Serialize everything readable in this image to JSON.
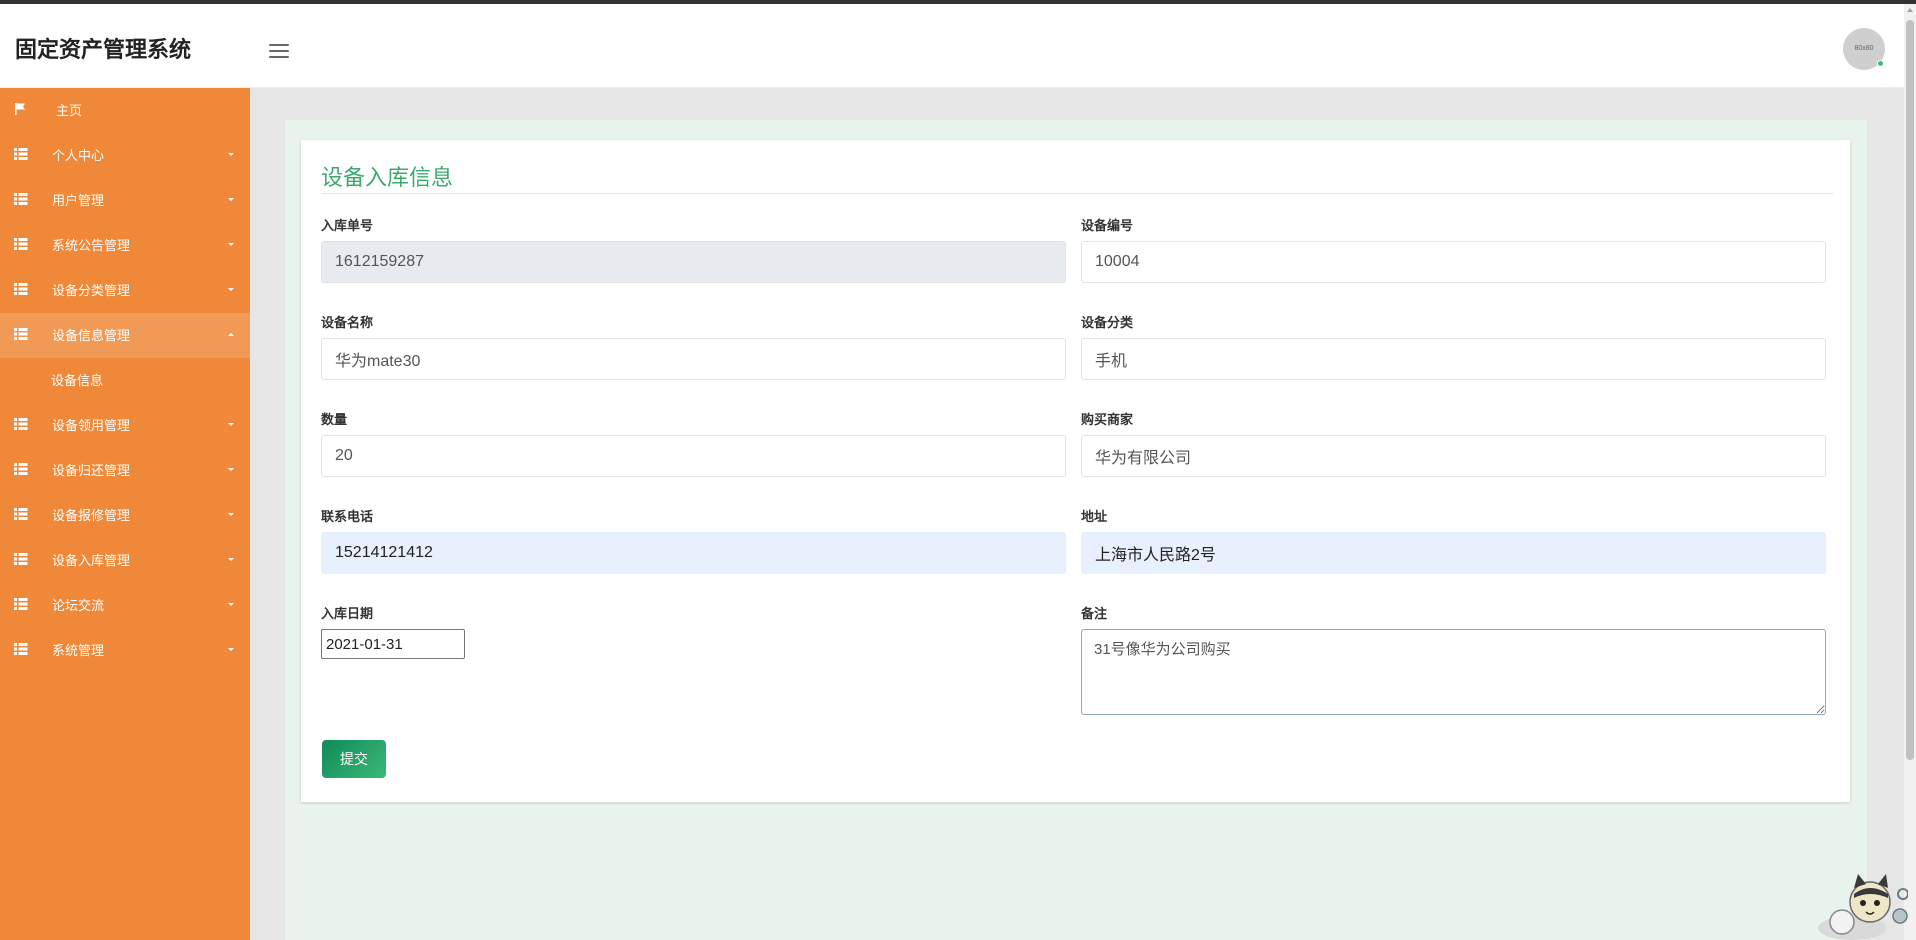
{
  "header": {
    "app_title": "固定资产管理系统",
    "avatar_text": "80x80"
  },
  "sidebar": {
    "items": [
      {
        "label": "主页",
        "icon": "flag-icon"
      },
      {
        "label": "个人中心",
        "icon": "grid-icon"
      },
      {
        "label": "用户管理",
        "icon": "grid-icon"
      },
      {
        "label": "系统公告管理",
        "icon": "grid-icon"
      },
      {
        "label": "设备分类管理",
        "icon": "grid-icon"
      },
      {
        "label": "设备信息管理",
        "icon": "grid-icon",
        "expanded": true
      },
      {
        "label": "设备领用管理",
        "icon": "grid-icon"
      },
      {
        "label": "设备归还管理",
        "icon": "grid-icon"
      },
      {
        "label": "设备报修管理",
        "icon": "grid-icon"
      },
      {
        "label": "设备入库管理",
        "icon": "grid-icon"
      },
      {
        "label": "论坛交流",
        "icon": "grid-icon"
      },
      {
        "label": "系统管理",
        "icon": "grid-icon"
      }
    ],
    "sub_item": "设备信息"
  },
  "form": {
    "title": "设备入库信息",
    "fields": {
      "order_no": {
        "label": "入库单号",
        "value": "1612159287"
      },
      "device_no": {
        "label": "设备编号",
        "value": "10004"
      },
      "device_name": {
        "label": "设备名称",
        "value": "华为mate30"
      },
      "category": {
        "label": "设备分类",
        "value": "手机"
      },
      "quantity": {
        "label": "数量",
        "value": "20"
      },
      "merchant": {
        "label": "购买商家",
        "value": "华为有限公司"
      },
      "phone": {
        "label": "联系电话",
        "value": "15214121412"
      },
      "address": {
        "label": "地址",
        "value": "上海市人民路2号"
      },
      "date": {
        "label": "入库日期",
        "value": "2021-01-31"
      },
      "remark": {
        "label": "备注",
        "value": "31号像华为公司购买"
      }
    },
    "submit_label": "提交"
  },
  "colors": {
    "sidebar": "#ef8838",
    "sidebar_active": "#f19a55",
    "title_green": "#3caa6f",
    "button_green": "#0e8a5a"
  }
}
